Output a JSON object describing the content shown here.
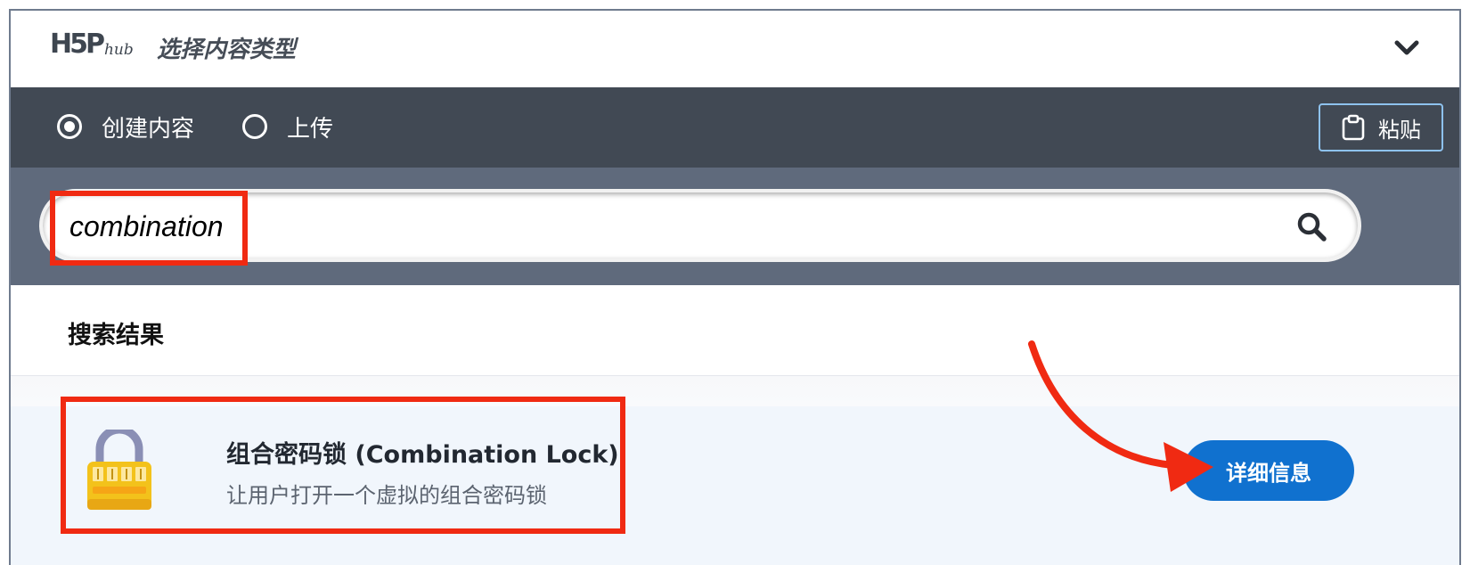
{
  "header": {
    "logo_main": "H5P",
    "logo_sub": "hub",
    "title": "选择内容类型"
  },
  "tabs": {
    "create_label": "创建内容",
    "upload_label": "上传",
    "paste_label": "粘贴"
  },
  "search": {
    "value": "combination"
  },
  "results": {
    "heading": "搜索结果",
    "items": [
      {
        "title": "组合密码锁 (Combination Lock)",
        "description": "让用户打开一个虚拟的组合密码锁",
        "details_label": "详细信息",
        "icon": "padlock-icon"
      }
    ]
  },
  "annotations": {
    "highlight_color": "#f02a12",
    "arrow_color": "#f02a12"
  },
  "colors": {
    "tabbar": "#414954",
    "searchbar": "#5f6a7c",
    "accent": "#1071cf"
  }
}
